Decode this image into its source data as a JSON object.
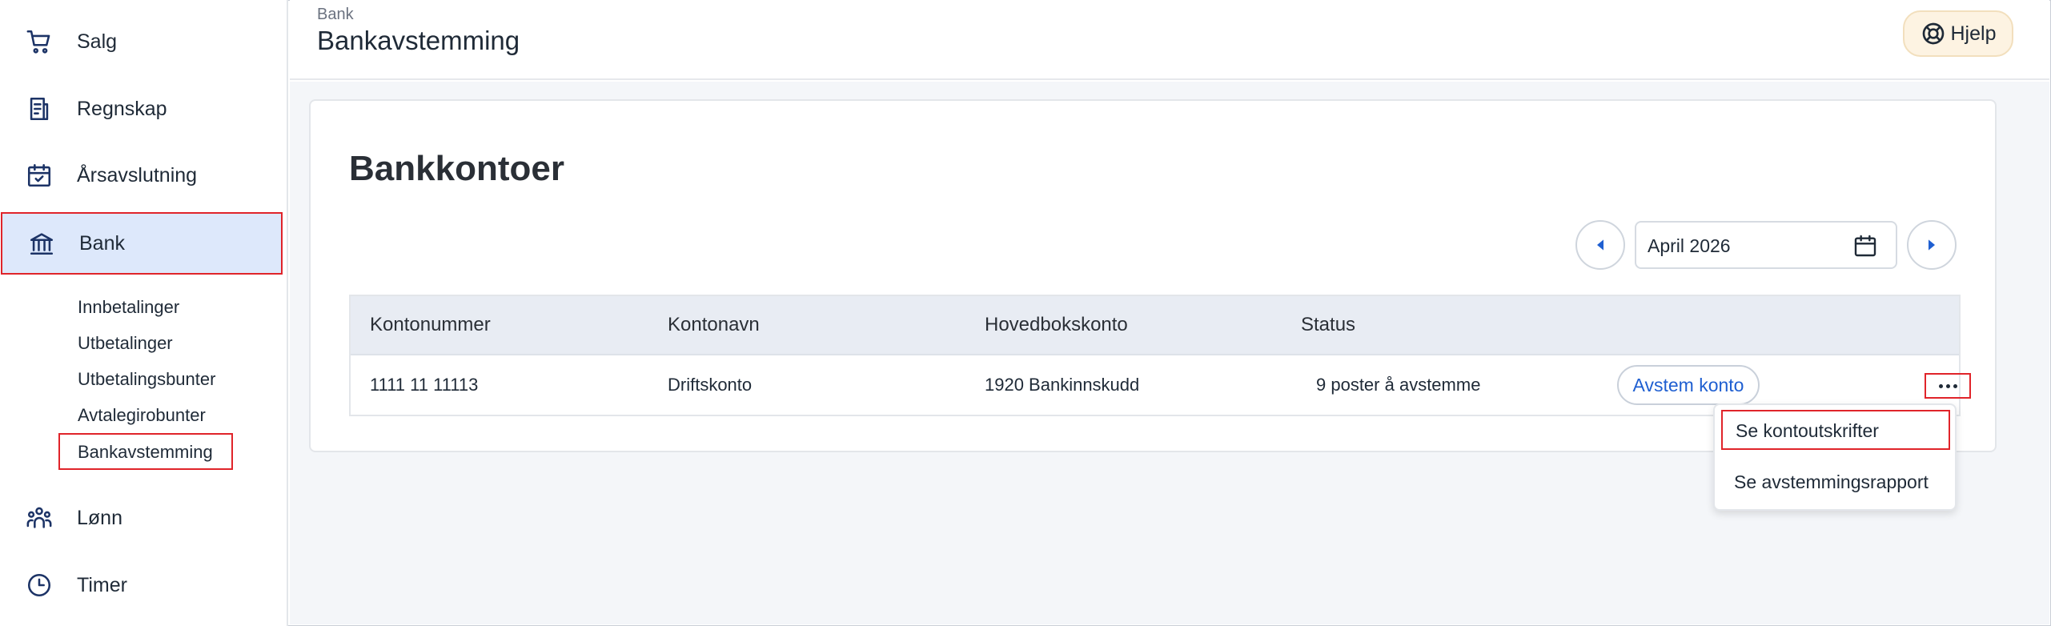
{
  "sidebar": {
    "items": [
      {
        "label": "Salg",
        "icon": "cart-icon"
      },
      {
        "label": "Regnskap",
        "icon": "ledger-icon"
      },
      {
        "label": "Årsavslutning",
        "icon": "calendar-check-icon"
      },
      {
        "label": "Bank",
        "icon": "bank-icon"
      },
      {
        "label": "Lønn",
        "icon": "people-icon"
      },
      {
        "label": "Timer",
        "icon": "clock-icon"
      }
    ],
    "bank_sub": [
      {
        "label": "Innbetalinger"
      },
      {
        "label": "Utbetalinger"
      },
      {
        "label": "Utbetalingsbunter"
      },
      {
        "label": "Avtalegirobunter"
      },
      {
        "label": "Bankavstemming"
      }
    ]
  },
  "header": {
    "breadcrumb": "Bank",
    "title": "Bankavstemming",
    "help_label": "Hjelp"
  },
  "main": {
    "card_title": "Bankkontoer",
    "date_value": "April 2026",
    "table": {
      "headers": [
        "Kontonummer",
        "Kontonavn",
        "Hovedbokskonto",
        "Status"
      ],
      "rows": [
        {
          "kontonummer": "1111 11 11113",
          "kontonavn": "Driftskonto",
          "hovedbokskonto": "1920 Bankinnskudd",
          "status": "9 poster å avstemme",
          "action_label": "Avstem konto"
        }
      ]
    },
    "dropdown": {
      "items": [
        "Se kontoutskrifter",
        "Se avstemmingsrapport"
      ]
    }
  },
  "colors": {
    "accent": "#1f5fd1",
    "active_bg": "#dde8fb",
    "highlight_border": "#e0242a",
    "icon": "#1c3366"
  }
}
